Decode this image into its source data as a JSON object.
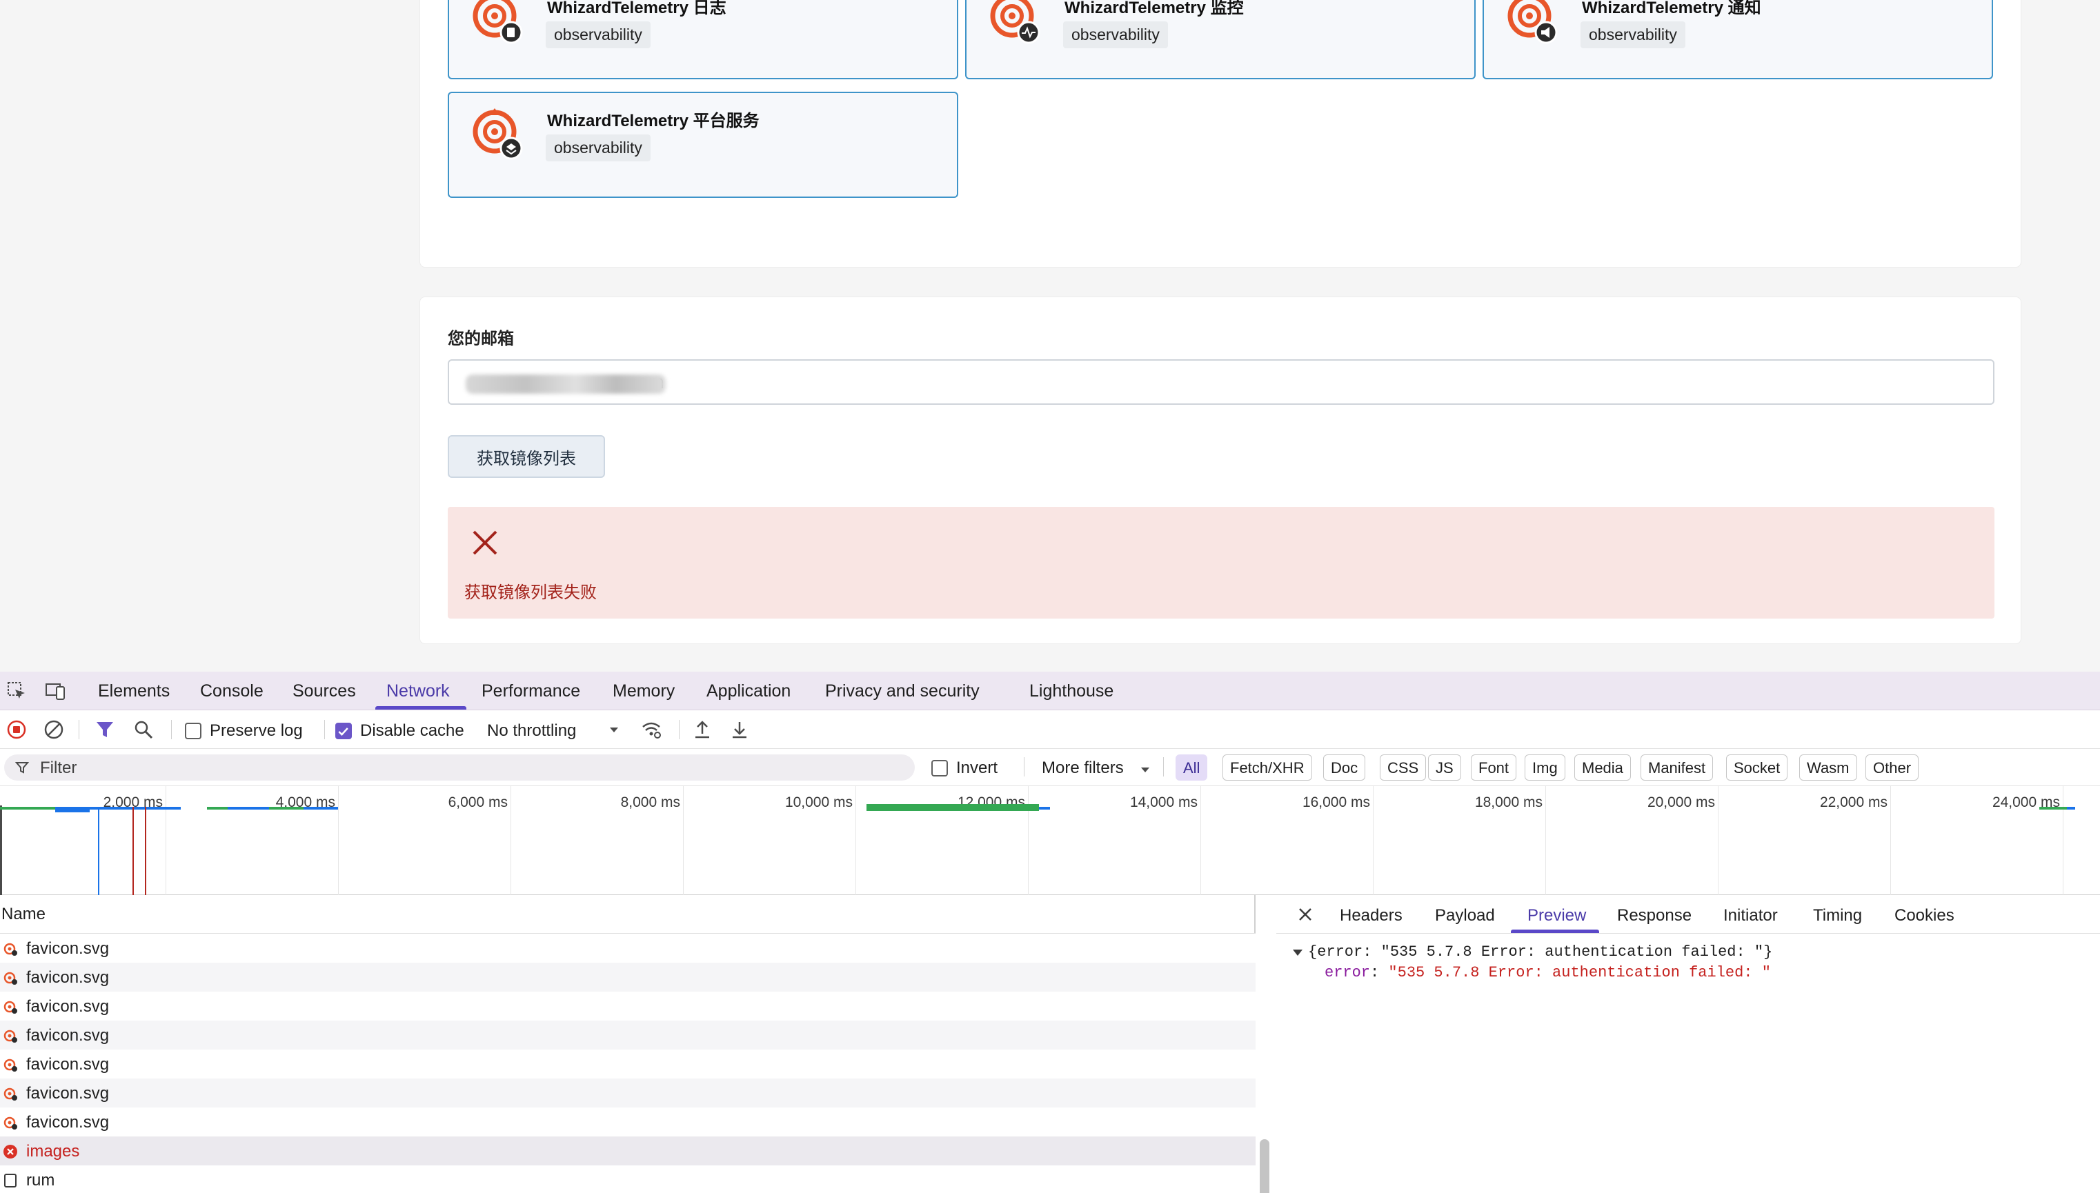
{
  "cards": [
    {
      "title": "WhizardTelemetry 日志",
      "tag": "observability",
      "badge": "doc-icon"
    },
    {
      "title": "WhizardTelemetry 监控",
      "tag": "observability",
      "badge": "pulse-icon"
    },
    {
      "title": "WhizardTelemetry 通知",
      "tag": "observability",
      "badge": "megaphone-icon"
    },
    {
      "title": "WhizardTelemetry 平台服务",
      "tag": "observability",
      "badge": "layers-icon"
    }
  ],
  "form": {
    "email_label": "您的邮箱",
    "email_value": "om",
    "fetch_button": "获取镜像列表",
    "error_message": "获取镜像列表失败"
  },
  "devtools": {
    "tabs": [
      "Elements",
      "Console",
      "Sources",
      "Network",
      "Performance",
      "Memory",
      "Application",
      "Privacy and security",
      "Lighthouse"
    ],
    "active_tab": "Network",
    "toolbar": {
      "preserve_log": "Preserve log",
      "disable_cache": "Disable cache",
      "throttling": "No throttling"
    },
    "filter": {
      "placeholder": "Filter",
      "invert": "Invert",
      "more_filters": "More filters",
      "types": [
        "All",
        "Fetch/XHR",
        "Doc",
        "CSS",
        "JS",
        "Font",
        "Img",
        "Media",
        "Manifest",
        "Socket",
        "Wasm",
        "Other"
      ],
      "active_type": "All"
    },
    "timeline_ticks": [
      "2,000 ms",
      "4,000 ms",
      "6,000 ms",
      "8,000 ms",
      "10,000 ms",
      "12,000 ms",
      "14,000 ms",
      "16,000 ms",
      "18,000 ms",
      "20,000 ms",
      "22,000 ms",
      "24,000 ms"
    ],
    "list_header": "Name",
    "requests": [
      {
        "name": "favicon.svg",
        "status": "ok"
      },
      {
        "name": "favicon.svg",
        "status": "ok"
      },
      {
        "name": "favicon.svg",
        "status": "ok"
      },
      {
        "name": "favicon.svg",
        "status": "ok"
      },
      {
        "name": "favicon.svg",
        "status": "ok"
      },
      {
        "name": "favicon.svg",
        "status": "ok"
      },
      {
        "name": "favicon.svg",
        "status": "ok"
      },
      {
        "name": "images",
        "status": "error"
      },
      {
        "name": "rum",
        "status": "doc"
      }
    ],
    "detail_tabs": [
      "Headers",
      "Payload",
      "Preview",
      "Response",
      "Initiator",
      "Timing",
      "Cookies"
    ],
    "active_detail_tab": "Preview",
    "preview": {
      "summary": "{error: \"535 5.7.8 Error: authentication failed: \"}",
      "key": "error",
      "value": "\"535 5.7.8 Error: authentication failed: \""
    }
  },
  "colors": {
    "card_border": "#3e94c9",
    "accent": "#5a48c8",
    "error": "#c5221f",
    "alert_bg": "#f9e5e3"
  }
}
